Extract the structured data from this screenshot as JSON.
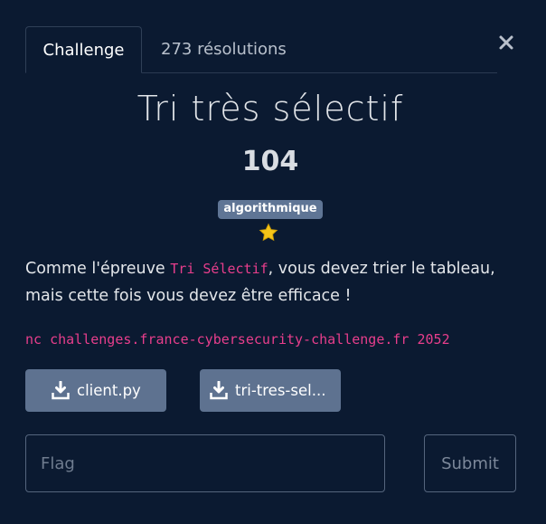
{
  "tabs": [
    {
      "label": "Challenge",
      "active": true
    },
    {
      "label": "273 résolutions",
      "active": false
    }
  ],
  "close_icon": "close-icon",
  "challenge": {
    "title": "Tri très sélectif",
    "value": "104",
    "tag": "algorithmique",
    "difficulty_icon": "star-icon",
    "difficulty_stars": 1,
    "description": {
      "part1": "Comme l'épreuve ",
      "code": "Tri Sélectif",
      "part2": ", vous devez trier le tableau, mais cette fois vous devez être efficace !"
    },
    "connection": "nc challenges.france-cybersecurity-challenge.fr 2052"
  },
  "files": [
    {
      "label": "client.py",
      "icon": "download-icon"
    },
    {
      "label": "tri-tres-sel...",
      "icon": "download-icon"
    }
  ],
  "form": {
    "flag_placeholder": "Flag",
    "flag_value": "",
    "submit_label": "Submit"
  },
  "colors": {
    "background": "#0b1a31",
    "tag_bg": "#5f7595",
    "button_bg": "#5e7290",
    "code": "#e83e8c",
    "star": "#f5c518"
  }
}
